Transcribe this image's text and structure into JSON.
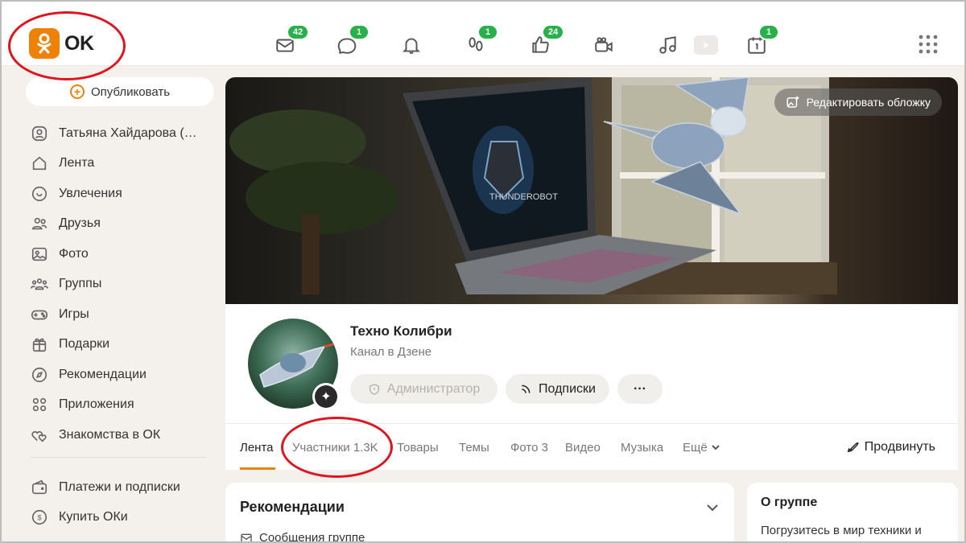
{
  "logo": {
    "text": "OK"
  },
  "topnav": [
    {
      "icon": "mail-icon",
      "badge": "42"
    },
    {
      "icon": "chat-icon",
      "badge": "1"
    },
    {
      "icon": "bell-icon",
      "badge": ""
    },
    {
      "icon": "footprints-icon",
      "badge": "1"
    },
    {
      "icon": "thumbs-up-icon",
      "badge": "24"
    },
    {
      "icon": "video-camera-icon",
      "badge": ""
    },
    {
      "icon": "music-note-icon",
      "badge": ""
    },
    {
      "icon": "video-play-icon",
      "badge": ""
    },
    {
      "icon": "calendar-icon",
      "badge": "1"
    }
  ],
  "sidebar": {
    "publish_label": "Опубликовать",
    "items": [
      {
        "label": "Татьяна Хайдарова (…",
        "icon": "user-icon"
      },
      {
        "label": "Лента",
        "icon": "home-icon"
      },
      {
        "label": "Увлечения",
        "icon": "hobby-icon"
      },
      {
        "label": "Друзья",
        "icon": "friends-icon"
      },
      {
        "label": "Фото",
        "icon": "photo-icon"
      },
      {
        "label": "Группы",
        "icon": "groups-icon"
      },
      {
        "label": "Игры",
        "icon": "gamepad-icon"
      },
      {
        "label": "Подарки",
        "icon": "gift-icon"
      },
      {
        "label": "Рекомендации",
        "icon": "compass-icon"
      },
      {
        "label": "Приложения",
        "icon": "apps-icon"
      },
      {
        "label": "Знакомства в ОК",
        "icon": "hearts-icon"
      }
    ],
    "items2": [
      {
        "label": "Платежи и подписки",
        "icon": "wallet-icon"
      },
      {
        "label": "Купить ОКи",
        "icon": "coin-icon"
      }
    ]
  },
  "cover": {
    "edit_label": "Редактировать обложку",
    "laptop_screen_text": "THUNDEROBOT"
  },
  "group": {
    "name": "Техно Колибри",
    "subtitle": "Канал в Дзене",
    "admin_label": "Администратор",
    "subscriptions_label": "Подписки",
    "more_label": "···"
  },
  "tabs": [
    {
      "label": "Лента",
      "active": true
    },
    {
      "label": "Участники 1.3K",
      "active": false
    },
    {
      "label": "Товары",
      "active": false
    },
    {
      "label": "Темы",
      "active": false
    },
    {
      "label": "Фото 3",
      "active": false
    },
    {
      "label": "Видео",
      "active": false
    },
    {
      "label": "Музыка",
      "active": false
    },
    {
      "label": "Ещё",
      "active": false
    }
  ],
  "promote_label": "Продвинуть",
  "recommendations": {
    "title": "Рекомендации",
    "sub": "Сообщения группе"
  },
  "about": {
    "title": "О группе",
    "text": "Погрузитесь в мир техники и"
  },
  "colors": {
    "accent": "#ee8208",
    "badge": "#28b04a",
    "annotation": "#e0141e"
  }
}
